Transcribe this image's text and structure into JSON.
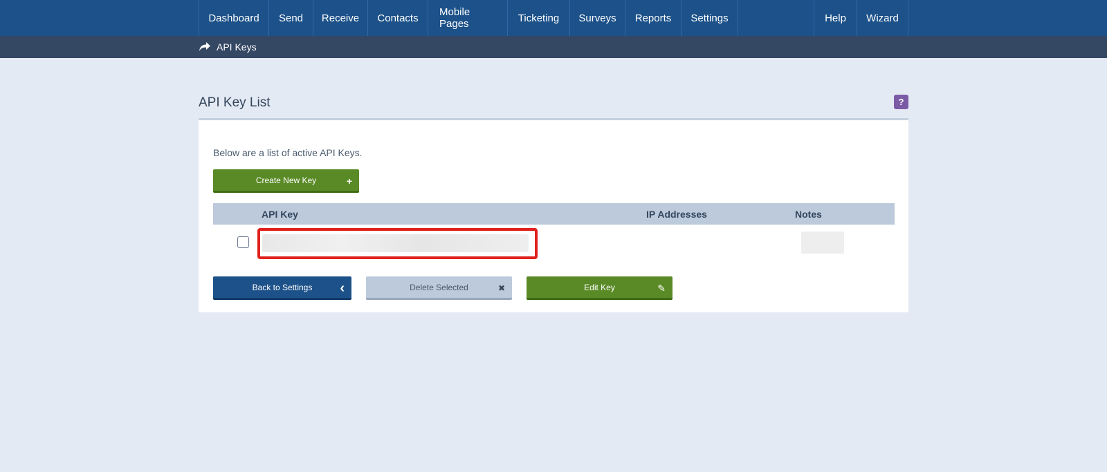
{
  "nav": {
    "left_items": [
      "Dashboard",
      "Send",
      "Receive",
      "Contacts",
      "Mobile Pages",
      "Ticketing",
      "Surveys",
      "Reports",
      "Settings"
    ],
    "right_items": [
      "Help",
      "Wizard"
    ]
  },
  "breadcrumb": {
    "label": "API Keys",
    "icon": "share-arrow-icon"
  },
  "page": {
    "title": "API Key List",
    "help_label": "?",
    "intro": "Below are a list of active API Keys."
  },
  "buttons": {
    "create": "Create New Key",
    "create_icon": "+",
    "back": "Back to Settings",
    "back_icon": "‹",
    "delete": "Delete Selected",
    "delete_icon": "✖",
    "edit": "Edit Key",
    "edit_icon": "✎"
  },
  "table": {
    "columns": [
      "API Key",
      "IP Addresses",
      "Notes"
    ],
    "rows": [
      {
        "checked": false,
        "api_key": "",
        "ip_addresses": "",
        "notes": ""
      }
    ]
  },
  "colors": {
    "nav_bg": "#1c5189",
    "subbar_bg": "#344763",
    "page_bg": "#e4eaf3",
    "green": "#5a8a26",
    "highlight_red": "#e0201c",
    "help_purple": "#7b5aa6"
  }
}
